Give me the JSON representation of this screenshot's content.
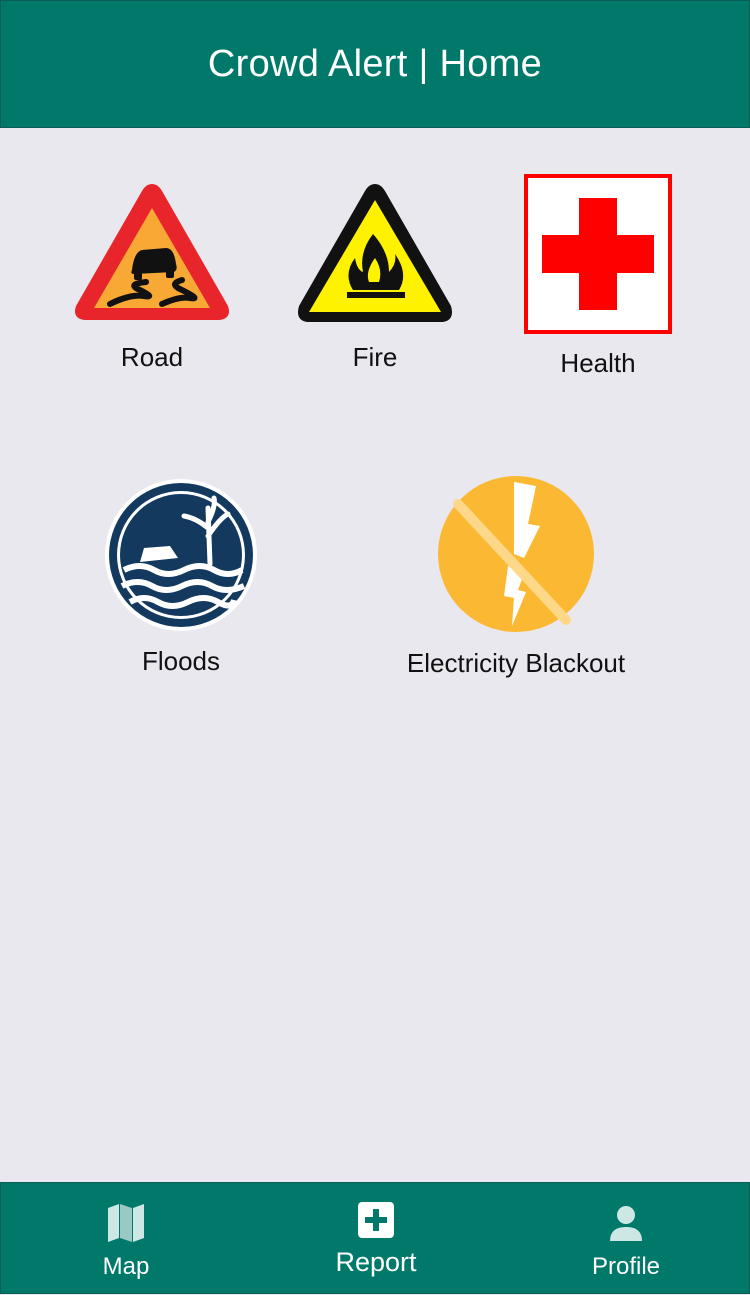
{
  "header": {
    "title": "Crowd Alert | Home"
  },
  "categories": [
    {
      "label": "Road",
      "icon": "slippery-road-sign-icon"
    },
    {
      "label": "Fire",
      "icon": "flammable-warning-icon"
    },
    {
      "label": "Health",
      "icon": "red-cross-icon"
    },
    {
      "label": "Floods",
      "icon": "flood-icon"
    },
    {
      "label": "Electricity Blackout",
      "icon": "no-electricity-icon"
    }
  ],
  "tabbar": {
    "items": [
      {
        "label": "Map",
        "icon": "map-icon"
      },
      {
        "label": "Report",
        "icon": "add-report-icon"
      },
      {
        "label": "Profile",
        "icon": "user-icon"
      }
    ]
  },
  "colors": {
    "primary": "#00796b",
    "background": "#e9e8ef",
    "health_red": "#ff0000",
    "road_orange": "#f7a835",
    "fire_yellow": "#fff200",
    "flood_navy": "#14395f",
    "blackout_amber": "#fbb933"
  }
}
